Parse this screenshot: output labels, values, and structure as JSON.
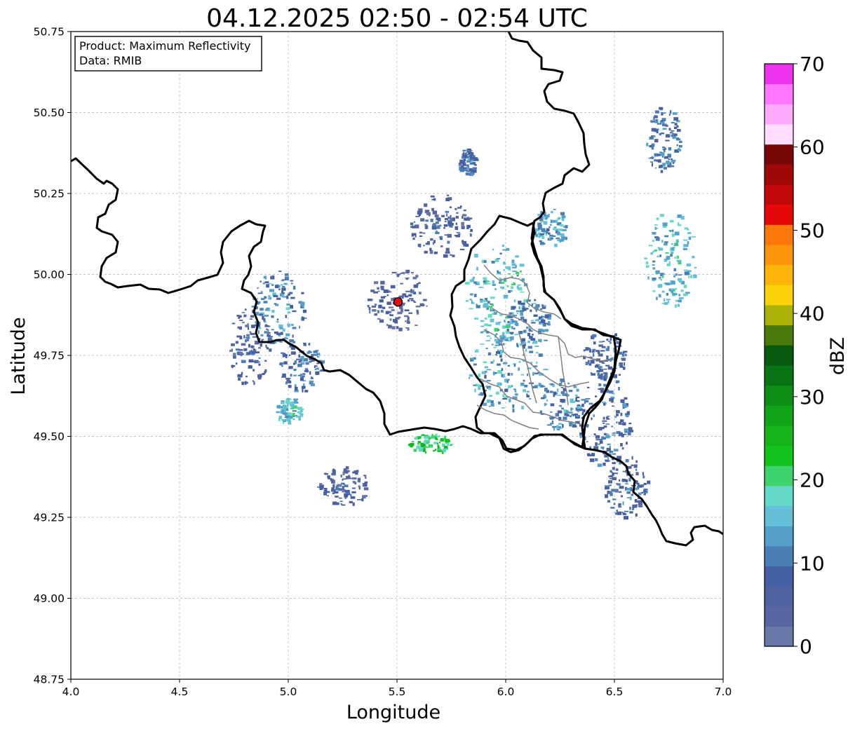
{
  "title": "04.12.2025 02:50 - 02:54 UTC",
  "info_box": {
    "product_line": "Product: Maximum Reflectivity",
    "data_line": "Data: RMIB"
  },
  "axes": {
    "xlabel": "Longitude",
    "ylabel": "Latitude",
    "xlim": [
      4.0,
      7.0
    ],
    "ylim": [
      48.75,
      50.75
    ],
    "xticks": [
      "4.0",
      "4.5",
      "5.0",
      "5.5",
      "6.0",
      "6.5",
      "7.0"
    ],
    "yticks": [
      "48.75",
      "49.00",
      "49.25",
      "49.50",
      "49.75",
      "50.00",
      "50.25",
      "50.50",
      "50.75"
    ],
    "grid": true
  },
  "radar_site": {
    "lon": 5.505,
    "lat": 49.915,
    "color": "#e01010"
  },
  "colorbar": {
    "label": "dBZ",
    "ticks": [
      "0",
      "10",
      "20",
      "30",
      "40",
      "50",
      "60",
      "70"
    ],
    "range": [
      0,
      70
    ],
    "colors": [
      "#6677aa",
      "#5566a0",
      "#4f62a0",
      "#4560a2",
      "#4a7fb5",
      "#55a0c8",
      "#64c0d8",
      "#66d8c8",
      "#3dd46e",
      "#14c41e",
      "#14b41a",
      "#10a418",
      "#0c8e14",
      "#087414",
      "#055a10",
      "#4a7a0c",
      "#aab208",
      "#fcd208",
      "#fcb408",
      "#fc9608",
      "#fc7808",
      "#e60808",
      "#c20808",
      "#a00808",
      "#780808",
      "#ffddff",
      "#ffaaff",
      "#ff77ff",
      "#ee33ee"
    ]
  },
  "chart_data": {
    "type": "heatmap",
    "title": "04.12.2025 02:50 - 02:54 UTC",
    "xlabel": "Longitude",
    "ylabel": "Latitude",
    "xlim": [
      4.0,
      7.0
    ],
    "ylim": [
      48.75,
      50.75
    ],
    "colorbar_label": "dBZ",
    "colorbar_range": [
      0,
      70
    ],
    "echo_clusters": [
      {
        "lon": 4.95,
        "lat": 49.9,
        "rlon": 0.12,
        "rlat": 0.12,
        "dbz": 12
      },
      {
        "lon": 5.05,
        "lat": 49.72,
        "rlon": 0.1,
        "rlat": 0.08,
        "dbz": 10
      },
      {
        "lon": 4.82,
        "lat": 49.78,
        "rlon": 0.1,
        "rlat": 0.12,
        "dbz": 6
      },
      {
        "lon": 5.0,
        "lat": 49.58,
        "rlon": 0.06,
        "rlat": 0.04,
        "dbz": 16
      },
      {
        "lon": 5.7,
        "lat": 50.15,
        "rlon": 0.14,
        "rlat": 0.1,
        "dbz": 6
      },
      {
        "lon": 5.82,
        "lat": 50.35,
        "rlon": 0.04,
        "rlat": 0.04,
        "dbz": 10
      },
      {
        "lon": 5.95,
        "lat": 49.95,
        "rlon": 0.14,
        "rlat": 0.16,
        "dbz": 16
      },
      {
        "lon": 6.0,
        "lat": 49.7,
        "rlon": 0.18,
        "rlat": 0.12,
        "dbz": 14
      },
      {
        "lon": 6.1,
        "lat": 49.85,
        "rlon": 0.1,
        "rlat": 0.08,
        "dbz": 12
      },
      {
        "lon": 6.25,
        "lat": 49.6,
        "rlon": 0.1,
        "rlat": 0.08,
        "dbz": 12
      },
      {
        "lon": 6.45,
        "lat": 49.55,
        "rlon": 0.12,
        "rlat": 0.14,
        "dbz": 10
      },
      {
        "lon": 6.45,
        "lat": 49.75,
        "rlon": 0.1,
        "rlat": 0.08,
        "dbz": 8
      },
      {
        "lon": 6.75,
        "lat": 50.05,
        "rlon": 0.12,
        "rlat": 0.15,
        "dbz": 16
      },
      {
        "lon": 6.72,
        "lat": 50.42,
        "rlon": 0.08,
        "rlat": 0.1,
        "dbz": 10
      },
      {
        "lon": 6.55,
        "lat": 49.35,
        "rlon": 0.1,
        "rlat": 0.1,
        "dbz": 8
      },
      {
        "lon": 5.5,
        "lat": 49.92,
        "rlon": 0.14,
        "rlat": 0.1,
        "dbz": 4
      },
      {
        "lon": 5.65,
        "lat": 49.48,
        "rlon": 0.1,
        "rlat": 0.03,
        "dbz": 22
      },
      {
        "lon": 5.25,
        "lat": 49.35,
        "rlon": 0.12,
        "rlat": 0.06,
        "dbz": 6
      },
      {
        "lon": 6.2,
        "lat": 50.15,
        "rlon": 0.08,
        "rlat": 0.06,
        "dbz": 14
      }
    ]
  }
}
